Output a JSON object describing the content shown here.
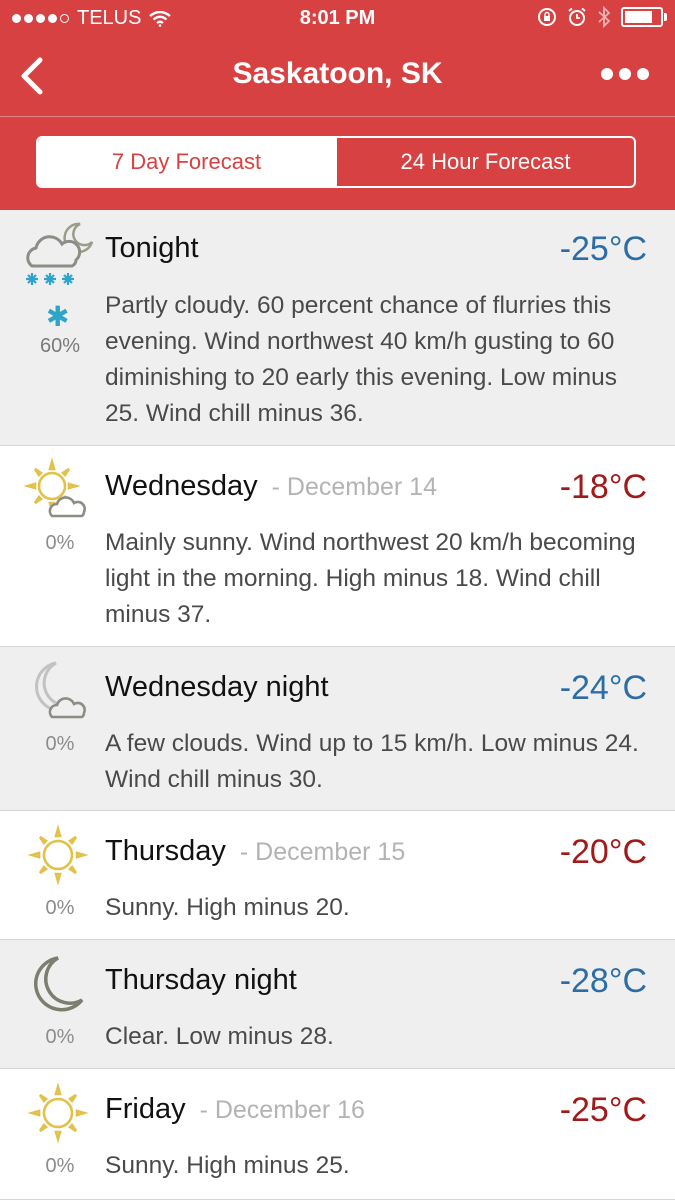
{
  "status_bar": {
    "carrier": "TELUS",
    "time": "8:01 PM",
    "battery_level": 0.9
  },
  "nav": {
    "title": "Saskatoon, SK",
    "back_icon": "chevron-left-icon",
    "more_icon": "more-dots-icon"
  },
  "tabs": [
    {
      "label": "7 Day Forecast",
      "active": true
    },
    {
      "label": "24 Hour Forecast",
      "active": false
    }
  ],
  "colors": {
    "brand_red": "#d84142",
    "cold_temp": "#2d6da5",
    "warm_temp": "#a11a1a",
    "snow_blue": "#2fa4c9",
    "sun_yellow": "#e2c14a"
  },
  "forecast": [
    {
      "period": "Tonight",
      "date": "",
      "temp": "-25°C",
      "pop": "60%",
      "icon": "cloudy-night-snow-icon",
      "description": "Partly cloudy. 60 percent chance of flurries this evening. Wind northwest 40 km/h gusting to 60 diminishing to 20 early this evening. Low minus 25. Wind chill minus 36."
    },
    {
      "period": "Wednesday",
      "date": "- December 14",
      "temp": "-18°C",
      "pop": "0%",
      "icon": "sun-with-cloud-icon",
      "description": "Mainly sunny. Wind northwest 20 km/h becoming light in the morning. High minus 18. Wind chill minus 37."
    },
    {
      "period": "Wednesday night",
      "date": "",
      "temp": "-24°C",
      "pop": "0%",
      "icon": "moon-with-cloud-icon",
      "description": "A few clouds. Wind up to 15 km/h. Low minus 24. Wind chill minus 30."
    },
    {
      "period": "Thursday",
      "date": "- December 15",
      "temp": "-20°C",
      "pop": "0%",
      "icon": "sun-icon",
      "description": "Sunny. High minus 20."
    },
    {
      "period": "Thursday night",
      "date": "",
      "temp": "-28°C",
      "pop": "0%",
      "icon": "moon-icon",
      "description": "Clear. Low minus 28."
    },
    {
      "period": "Friday",
      "date": "- December 16",
      "temp": "-25°C",
      "pop": "0%",
      "icon": "sun-icon",
      "description": "Sunny. High minus 25."
    }
  ]
}
